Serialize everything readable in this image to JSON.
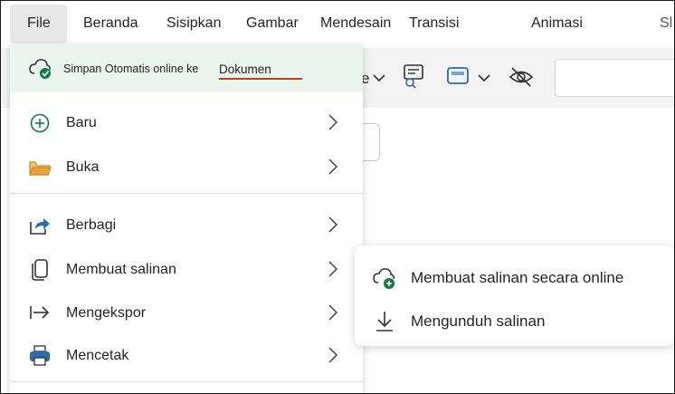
{
  "tabs": {
    "file": "File",
    "home": "Beranda",
    "insert": "Sisipkan",
    "draw": "Gambar",
    "design": "Mendesain",
    "transitions": "Transisi",
    "animations": "Animasi",
    "slideshow_partial": "Sl"
  },
  "ribbon": {
    "partial_text": "e"
  },
  "autosave": {
    "text": "Simpan Otomatis online ke",
    "location": "Dokumen"
  },
  "menu": {
    "items": [
      {
        "label": "Baru",
        "icon": "add-circle-icon"
      },
      {
        "label": "Buka",
        "icon": "folder-icon"
      },
      {
        "label": "Berbagi",
        "icon": "share-icon"
      },
      {
        "label": "Membuat salinan",
        "icon": "copy-icon"
      },
      {
        "label": "Mengekspor",
        "icon": "export-icon"
      },
      {
        "label": "Mencetak",
        "icon": "print-icon"
      }
    ]
  },
  "submenu": {
    "items": [
      {
        "label": "Membuat salinan secara online",
        "icon": "cloud-add-icon"
      },
      {
        "label": "Mengunduh salinan",
        "icon": "download-icon"
      }
    ]
  },
  "colors": {
    "accent_green": "#107c41",
    "autosave_bg": "#eaf5ef",
    "underline_red": "#c43e1c",
    "ribbon_bg": "#f3f3f3",
    "print_blue": "#2b6cb0",
    "folder_orange": "#e8a33d"
  }
}
